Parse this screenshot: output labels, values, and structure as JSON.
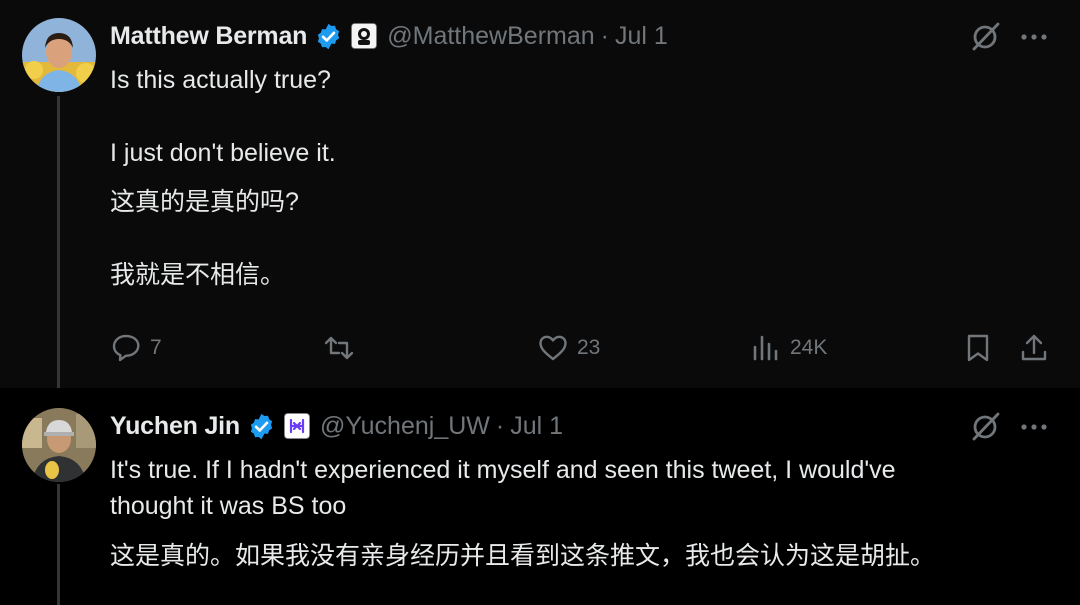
{
  "tweets": [
    {
      "author_name": "Matthew Berman",
      "handle": "@MatthewBerman",
      "separator": "·",
      "date": "Jul 1",
      "body": [
        "Is this actually true?",
        "I just don't believe it.",
        "这真的是真的吗?",
        "我就是不相信。"
      ],
      "actions": {
        "replies": "7",
        "retweets": "",
        "likes": "23",
        "views": "24K"
      },
      "avatar_icon": "avatar-photo-man-blue-shirt",
      "affiliation_icon": "forward-future-badge-icon"
    },
    {
      "author_name": "Yuchen Jin",
      "handle": "@Yuchenj_UW",
      "separator": "·",
      "date": "Jul 1",
      "body": [
        "It's true. If I hadn't experienced it myself and seen this tweet, I would've",
        "thought it was BS too",
        "这是真的。如果我没有亲身经历并且看到这条推文，我也会认为这是胡扯。"
      ],
      "avatar_icon": "avatar-photo-man-cap",
      "affiliation_icon": "hyperbolic-badge-icon"
    }
  ],
  "colors": {
    "background": "#000000",
    "text": "#e7e9ea",
    "muted": "#71767b",
    "verified": "#1d9bf0",
    "thread_line": "#333639"
  }
}
